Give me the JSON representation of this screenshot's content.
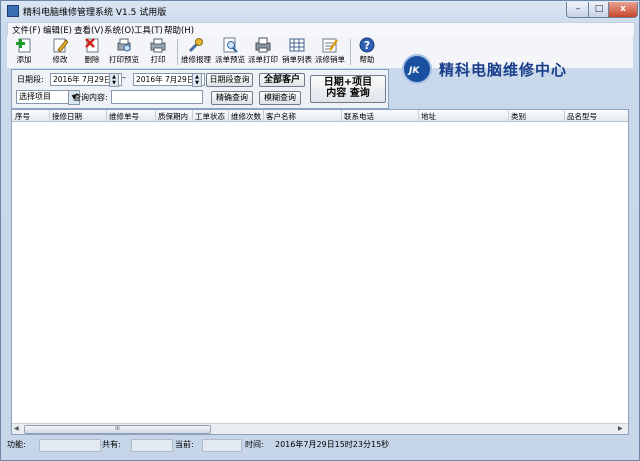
{
  "window": {
    "title": "精科电脑维修管理系统 V1.5 试用版",
    "controls": {
      "minimize": "–",
      "maximize": "□",
      "close": "x"
    }
  },
  "menu": [
    "文件(F)",
    "编辑(E)",
    "查看(V)",
    "系统(O)",
    "工具(T)",
    "帮助(H)"
  ],
  "toolbar": [
    {
      "label": "添加",
      "icon": "add-icon"
    },
    {
      "label": "修改",
      "icon": "edit-icon"
    },
    {
      "label": "删除",
      "icon": "delete-icon"
    },
    {
      "label": "打印预览",
      "icon": "print-preview-icon"
    },
    {
      "label": "打印",
      "icon": "print-icon"
    },
    {
      "label": "维修报理",
      "icon": "repair-icon"
    },
    {
      "label": "派单预览",
      "icon": "dispatch-preview-icon"
    },
    {
      "label": "派单打印",
      "icon": "dispatch-print-icon"
    },
    {
      "label": "销单列表",
      "icon": "list-icon"
    },
    {
      "label": "派修销单",
      "icon": "cancel-order-icon"
    },
    {
      "label": "帮助",
      "icon": "help-icon"
    }
  ],
  "logo": {
    "text": "精科电脑维修中心",
    "badge": "JK"
  },
  "filter": {
    "date_label": "日期段:",
    "date_from": "2016年 7月29日",
    "date_sep": "–",
    "date_to": "2016年 7月29日",
    "date_query_button": "日期段查询",
    "all_customers_button": "全部客户",
    "combined_query_button_line1": "日期+项目",
    "combined_query_button_line2": "内容 查询",
    "item_select": "选择项目",
    "query_content_label": "查询内容:",
    "exact_query_button": "精确查询",
    "fuzzy_query_button": "模糊查询"
  },
  "grid": {
    "columns": [
      "序号",
      "接修日期",
      "维修单号",
      "质保期内",
      "工单状态",
      "维修次数",
      "客户名称",
      "联系电话",
      "地址",
      "类别",
      "品名型号"
    ],
    "scroll_thumb": "III"
  },
  "statusbar": {
    "function_label": "功能:",
    "total_label": "共有:",
    "current_label": "当前:",
    "time_label": "时间:",
    "time_value": "2016年7月29日15时23分15秒"
  }
}
